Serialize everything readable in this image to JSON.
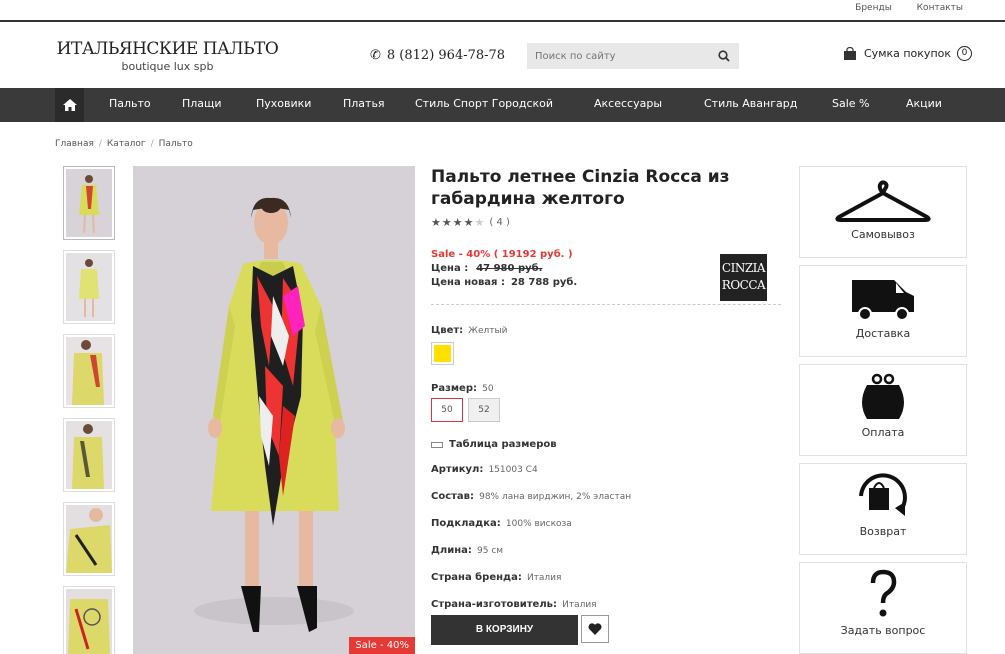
{
  "top_links": [
    "Бренды",
    "Контакты"
  ],
  "logo": {
    "main": "ИТАЛЬЯНСКИЕ ПАЛЬТО",
    "sub": "boutique lux spb"
  },
  "phone": "8 (812) 964-78-78",
  "search": {
    "placeholder": "Поиск по сайту"
  },
  "cart": {
    "label": "Сумка покупок",
    "count": "0"
  },
  "nav": [
    "Пальто",
    "Плащи",
    "Пуховики",
    "Платья",
    "Стиль Спорт Городской",
    "Аксессуары",
    "Стиль Авангард",
    "Sale %",
    "Акции"
  ],
  "breadcrumbs": [
    "Главная",
    "Каталог",
    "Пальто"
  ],
  "product": {
    "title": "Пальто летнее Cinzia Rocca из габардина желтого",
    "rating": 4,
    "rating_count": "( 4 )",
    "sale_text": "Sale - 40% ( 19192 руб. )",
    "price_label": "Цена :",
    "price_old": "47 980 руб.",
    "price_new_label": "Цена новая :",
    "price_new": "28 788 руб.",
    "brand_line1": "CINZIA",
    "brand_line2": "ROCCA",
    "color_label": "Цвет:",
    "color_value": "Желтый",
    "color_hex": "#ffe000",
    "size_label": "Размер:",
    "size_value": "50",
    "sizes": [
      "50",
      "52"
    ],
    "size_table": "Таблица размеров",
    "specs": [
      {
        "label": "Артикул:",
        "value": "151003 С4"
      },
      {
        "label": "Состав:",
        "value": "98% лана вирджин, 2% эластан"
      },
      {
        "label": "Подкладка:",
        "value": "100% вискоза"
      },
      {
        "label": "Длина:",
        "value": "95 см"
      },
      {
        "label": "Страна бренда:",
        "value": "Италия"
      },
      {
        "label": "Страна-изготовитель:",
        "value": "Италия"
      }
    ],
    "buy_label": "В КОРЗИНУ",
    "sale_badge": "Sale - 40%"
  },
  "services": [
    "Самовывоз",
    "Доставка",
    "Оплата",
    "Возврат",
    "Задать вопрос"
  ],
  "colors": {
    "nav_bg": "#3a3a3a",
    "sale_red": "#e53935",
    "coat_yellow": "#d9dc5a"
  }
}
